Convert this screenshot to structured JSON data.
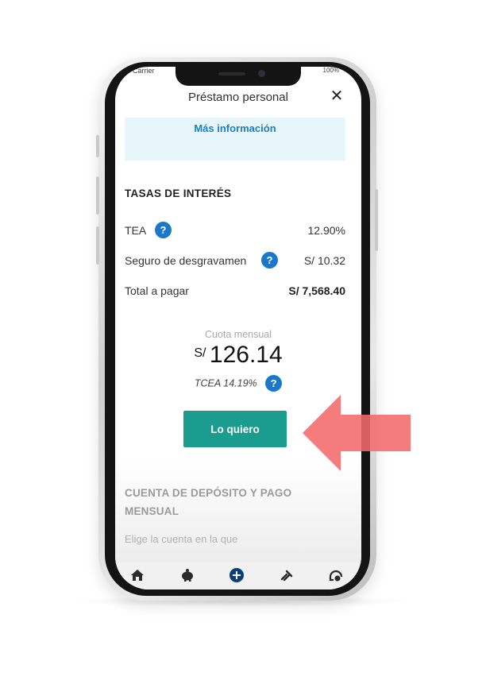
{
  "status_bar": {
    "carrier": "Carrier",
    "battery": "100%"
  },
  "header": {
    "title": "Préstamo personal",
    "close_icon": "close-icon"
  },
  "info_link": "Más información",
  "rates": {
    "section_title": "TASAS DE INTERÉS",
    "rows": [
      {
        "label": "TEA",
        "value": "12.90%",
        "help": true,
        "bold": false
      },
      {
        "label": "Seguro de desgravamen",
        "value": "S/ 10.32",
        "help": true,
        "bold": false
      },
      {
        "label": "Total a pagar",
        "value": "S/ 7,568.40",
        "help": false,
        "bold": true
      }
    ]
  },
  "cuota": {
    "label": "Cuota mensual",
    "currency": "S/",
    "amount": "126.14",
    "tcea": "TCEA 14.19%"
  },
  "cta_label": "Lo quiero",
  "deposit_section": {
    "title": "CUENTA DE DEPÓSITO Y PAGO MENSUAL",
    "subtitle": "Elige la cuenta en la que"
  },
  "tabbar": {
    "icons": [
      "home-icon",
      "piggy-bank-icon",
      "plus-circle-icon",
      "transfer-icon",
      "support-icon"
    ]
  },
  "colors": {
    "accent_teal": "#1a9c8f",
    "help_blue": "#1a77c9",
    "link_blue": "#1a7fc4",
    "info_bg": "#e6f6fb",
    "arrow_red": "#f46a6a"
  },
  "help_glyph": "?"
}
